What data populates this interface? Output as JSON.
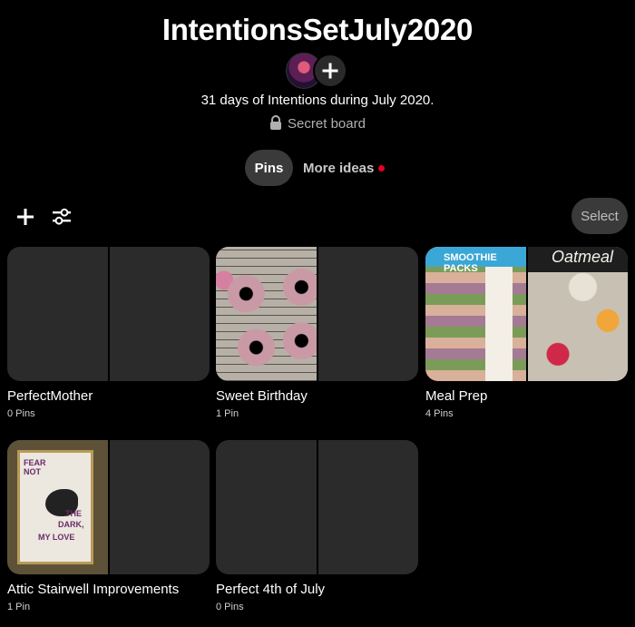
{
  "board": {
    "title": "IntentionsSetJuly2020",
    "description": "31 days of Intentions during July 2020.",
    "privacy": "Secret board"
  },
  "tabs": {
    "pins": "Pins",
    "more_ideas": "More ideas"
  },
  "toolbar": {
    "select_label": "Select",
    "add_icon": "plus-icon",
    "filter_icon": "sliders-icon"
  },
  "sections": [
    {
      "name": "PerfectMother",
      "count": "0 Pins"
    },
    {
      "name": "Sweet Birthday",
      "count": "1 Pin"
    },
    {
      "name": "Meal Prep",
      "count": "4 Pins"
    },
    {
      "name": "Attic Stairwell Improvements",
      "count": "1 Pin"
    },
    {
      "name": "Perfect 4th of July",
      "count": "0 Pins"
    }
  ],
  "covers": {
    "smoothie_title": "SMOOTHIE PACKS",
    "oatmeal_title": "Oatmeal",
    "crow_text": [
      "FEAR",
      "NOT",
      "THE",
      "DARK,",
      "MY LOVE"
    ]
  },
  "colors": {
    "background": "#000000",
    "pill": "#3a3a3a",
    "notification_dot": "#e60023"
  }
}
